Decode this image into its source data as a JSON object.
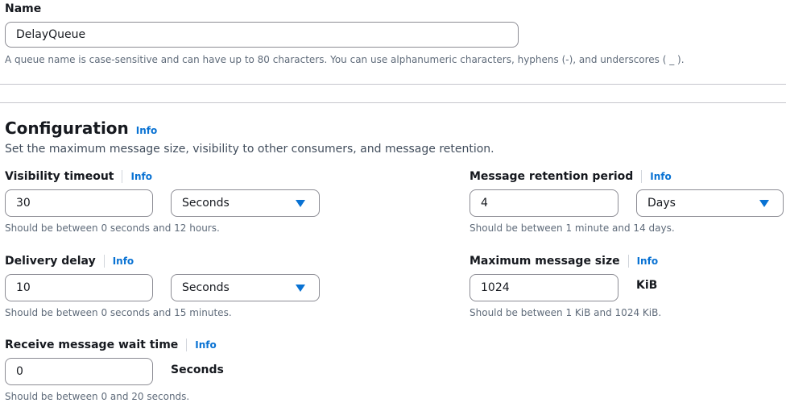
{
  "name": {
    "label": "Name",
    "value": "DelayQueue",
    "hint": "A queue name is case-sensitive and can have up to 80 characters. You can use alphanumeric characters, hyphens (-), and underscores ( _ )."
  },
  "configuration": {
    "title": "Configuration",
    "info": "Info",
    "description": "Set the maximum message size, visibility to other consumers, and message retention."
  },
  "visibility_timeout": {
    "label": "Visibility timeout",
    "info": "Info",
    "value": "30",
    "unit": "Seconds",
    "hint": "Should be between 0 seconds and 12 hours."
  },
  "message_retention": {
    "label": "Message retention period",
    "info": "Info",
    "value": "4",
    "unit": "Days",
    "hint": "Should be between 1 minute and 14 days."
  },
  "delivery_delay": {
    "label": "Delivery delay",
    "info": "Info",
    "value": "10",
    "unit": "Seconds",
    "hint": "Should be between 0 seconds and 15 minutes."
  },
  "max_message_size": {
    "label": "Maximum message size",
    "info": "Info",
    "value": "1024",
    "unit": "KiB",
    "hint": "Should be between 1 KiB and 1024 KiB."
  },
  "receive_wait_time": {
    "label": "Receive message wait time",
    "info": "Info",
    "value": "0",
    "unit": "Seconds",
    "hint": "Should be between 0 and 20 seconds."
  },
  "colors": {
    "link": "#0972d3",
    "text": "#16191f",
    "hint": "#5f6b7a",
    "border": "#8c8c94"
  },
  "icons": {
    "dropdown": "caret-down-icon"
  }
}
